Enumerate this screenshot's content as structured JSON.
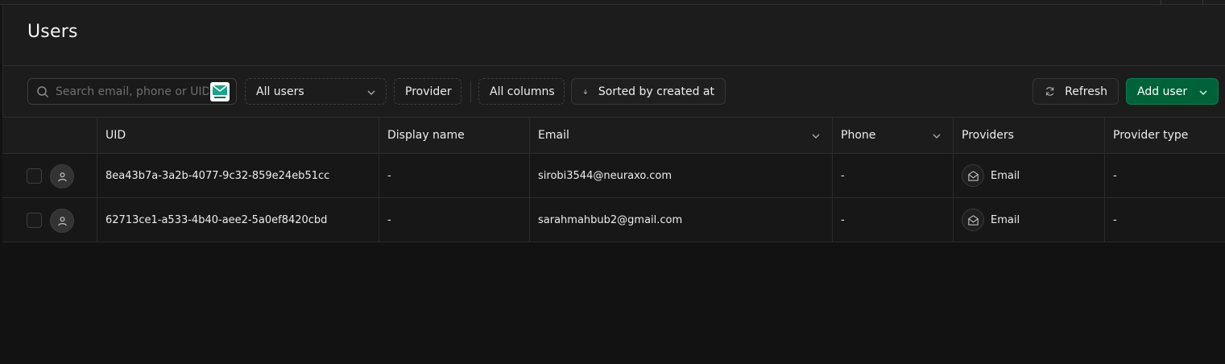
{
  "page": {
    "title": "Users"
  },
  "toolbar": {
    "search_placeholder": "Search email, phone or UID",
    "filter_users": "All users",
    "provider": "Provider",
    "columns": "All columns",
    "sort": "Sorted by created at",
    "refresh": "Refresh",
    "add_user": "Add user"
  },
  "table": {
    "columns": [
      "UID",
      "Display name",
      "Email",
      "Phone",
      "Providers",
      "Provider type"
    ],
    "rows": [
      {
        "uid": "8ea43b7a-3a2b-4077-9c32-859e24eb51cc",
        "display_name": "-",
        "email": "sirobi3544@neuraxo.com",
        "phone": "-",
        "provider": "Email",
        "provider_type": "-"
      },
      {
        "uid": "62713ce1-a533-4b40-aee2-5a0ef8420cbd",
        "display_name": "-",
        "email": "sarahmahbub2@gmail.com",
        "phone": "-",
        "provider": "Email",
        "provider_type": "-"
      }
    ]
  },
  "colors": {
    "background": "#121212",
    "panel": "#1c1c1c",
    "accent_green": "#006239",
    "border": "#2e2e2e"
  },
  "icons": [
    "search-icon",
    "mail-extension-icon",
    "chevron-down-icon",
    "arrow-down-icon",
    "refresh-icon",
    "user-icon",
    "envelope-icon"
  ]
}
